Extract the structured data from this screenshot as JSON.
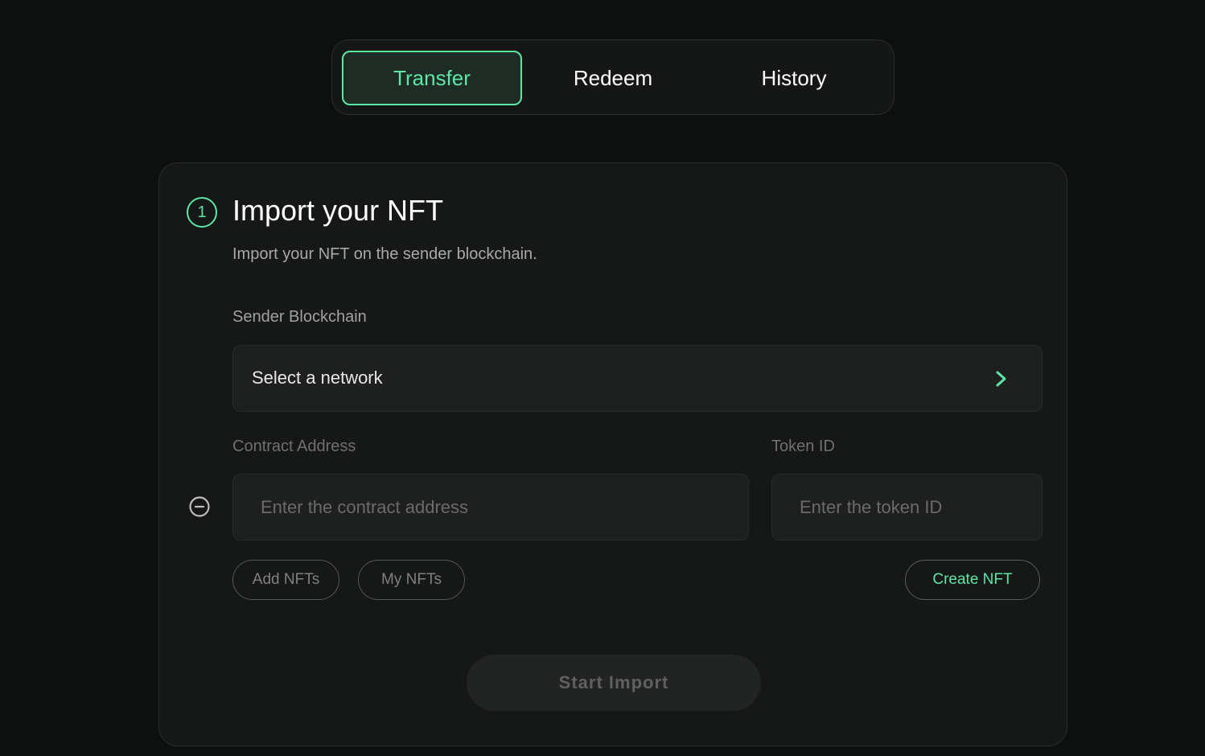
{
  "tabs": [
    {
      "label": "Transfer",
      "active": true
    },
    {
      "label": "Redeem",
      "active": false
    },
    {
      "label": "History",
      "active": false
    }
  ],
  "step": {
    "number": "1",
    "title": "Import your NFT",
    "subtitle": "Import your NFT on the sender blockchain."
  },
  "form": {
    "sender_label": "Sender Blockchain",
    "sender_value": "Select a network",
    "contract_label": "Contract Address",
    "contract_placeholder": "Enter the contract address",
    "contract_value": "",
    "token_label": "Token ID",
    "token_placeholder": "Enter the token ID",
    "token_value": ""
  },
  "buttons": {
    "add_nfts": "Add NFTs",
    "my_nfts": "My NFTs",
    "create_nft": "Create NFT",
    "start_import": "Start Import"
  },
  "colors": {
    "accent": "#5ee6a5",
    "background": "#0e0f0f",
    "card": "#161717"
  }
}
